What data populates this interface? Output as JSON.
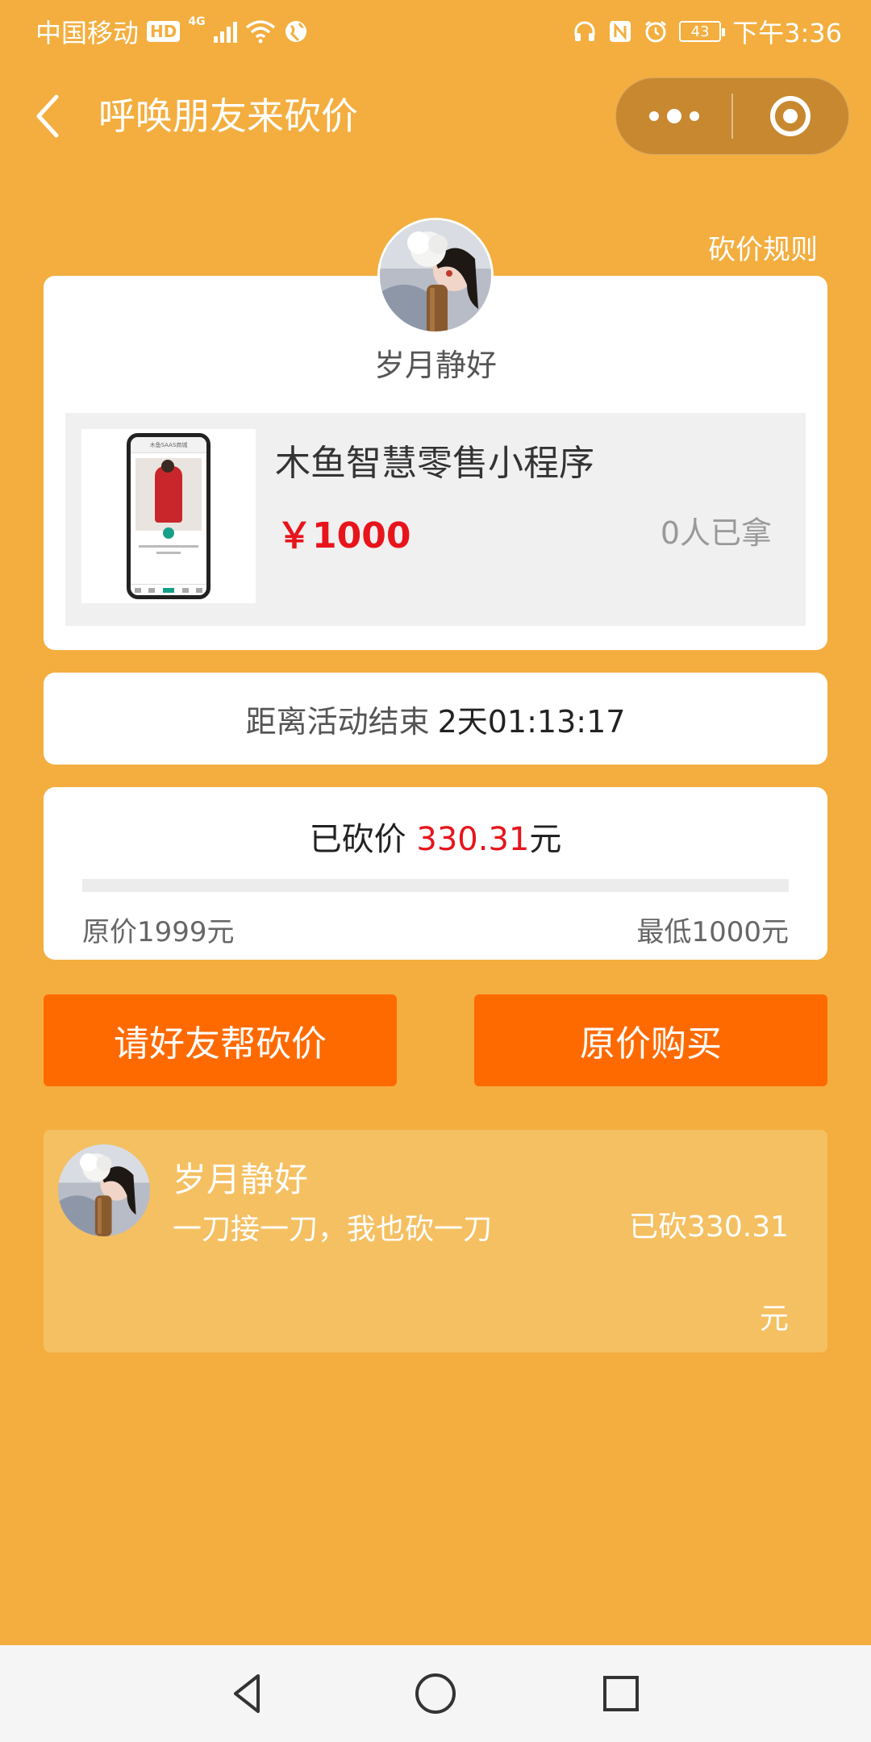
{
  "status_bar": {
    "carrier": "中国移动",
    "hd": "HD",
    "network": "4G",
    "battery": "43",
    "time": "下午3:36"
  },
  "nav": {
    "title": "呼唤朋友来砍价"
  },
  "rule_link": "砍价规则",
  "profile": {
    "username": "岁月静好"
  },
  "product": {
    "name": "木鱼智慧零售小程序",
    "price": "￥1000",
    "taken": "0人已拿",
    "thumb_caption": "木鱼SAAS商城"
  },
  "countdown": {
    "label": "距离活动结束",
    "value": "2天01:13:17"
  },
  "progress": {
    "prefix": "已砍价 ",
    "amount": "330.31",
    "suffix": "元",
    "fraction": 0.0,
    "original_price": "原价1999元",
    "min_price": "最低1000元"
  },
  "buttons": {
    "help": "请好友帮砍价",
    "buy": "原价购买"
  },
  "record": {
    "name": "岁月静好",
    "message": "一刀接一刀，我也砍一刀",
    "amount": "已砍330.31元"
  },
  "colors": {
    "background": "#f3ae3f",
    "button": "#ff6a00",
    "price_red": "#e8141c"
  },
  "icons": {
    "back": "back-chevron-icon",
    "more": "more-dots-icon",
    "close": "target-close-icon",
    "android_back": "triangle-back-icon",
    "android_home": "circle-home-icon",
    "android_recent": "square-recent-icon"
  }
}
